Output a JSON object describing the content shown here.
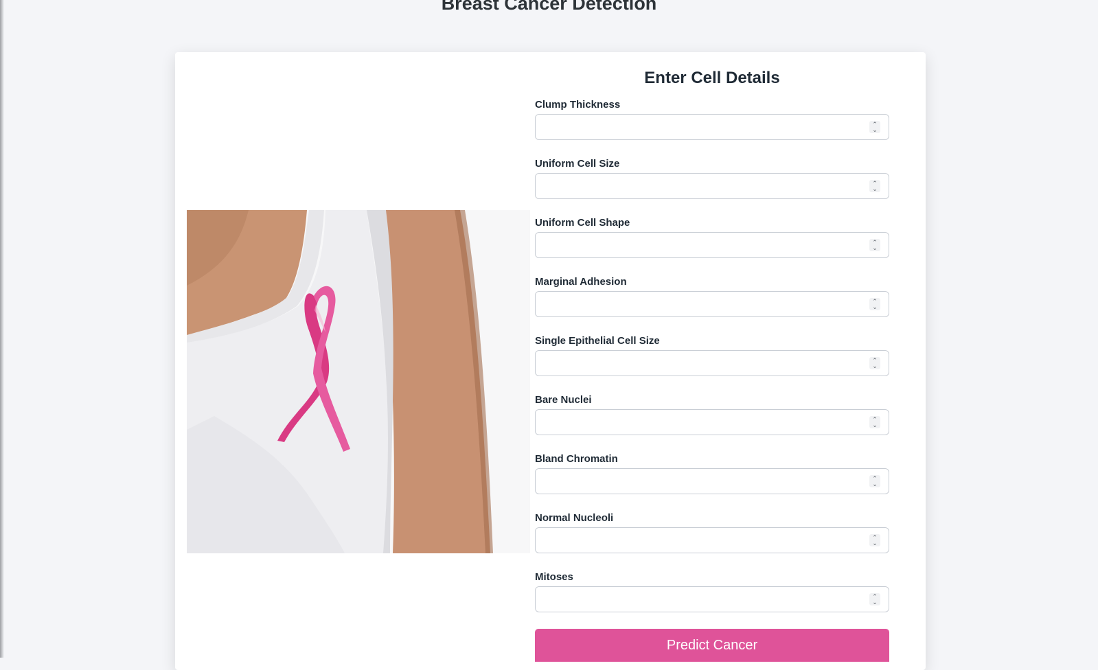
{
  "page": {
    "title": "Breast Cancer Detection"
  },
  "form": {
    "title": "Enter Cell Details",
    "fields": [
      {
        "label": "Clump Thickness",
        "value": ""
      },
      {
        "label": "Uniform Cell Size",
        "value": ""
      },
      {
        "label": "Uniform Cell Shape",
        "value": ""
      },
      {
        "label": "Marginal Adhesion",
        "value": ""
      },
      {
        "label": "Single Epithelial Cell Size",
        "value": ""
      },
      {
        "label": "Bare Nuclei",
        "value": ""
      },
      {
        "label": "Bland Chromatin",
        "value": ""
      },
      {
        "label": "Normal Nucleoli",
        "value": ""
      },
      {
        "label": "Mitoses",
        "value": ""
      }
    ],
    "submit_label": "Predict Cancer"
  },
  "colors": {
    "accent": "#df5399",
    "ribbon": "#e0468e",
    "page_background": "#f4f5f8"
  }
}
